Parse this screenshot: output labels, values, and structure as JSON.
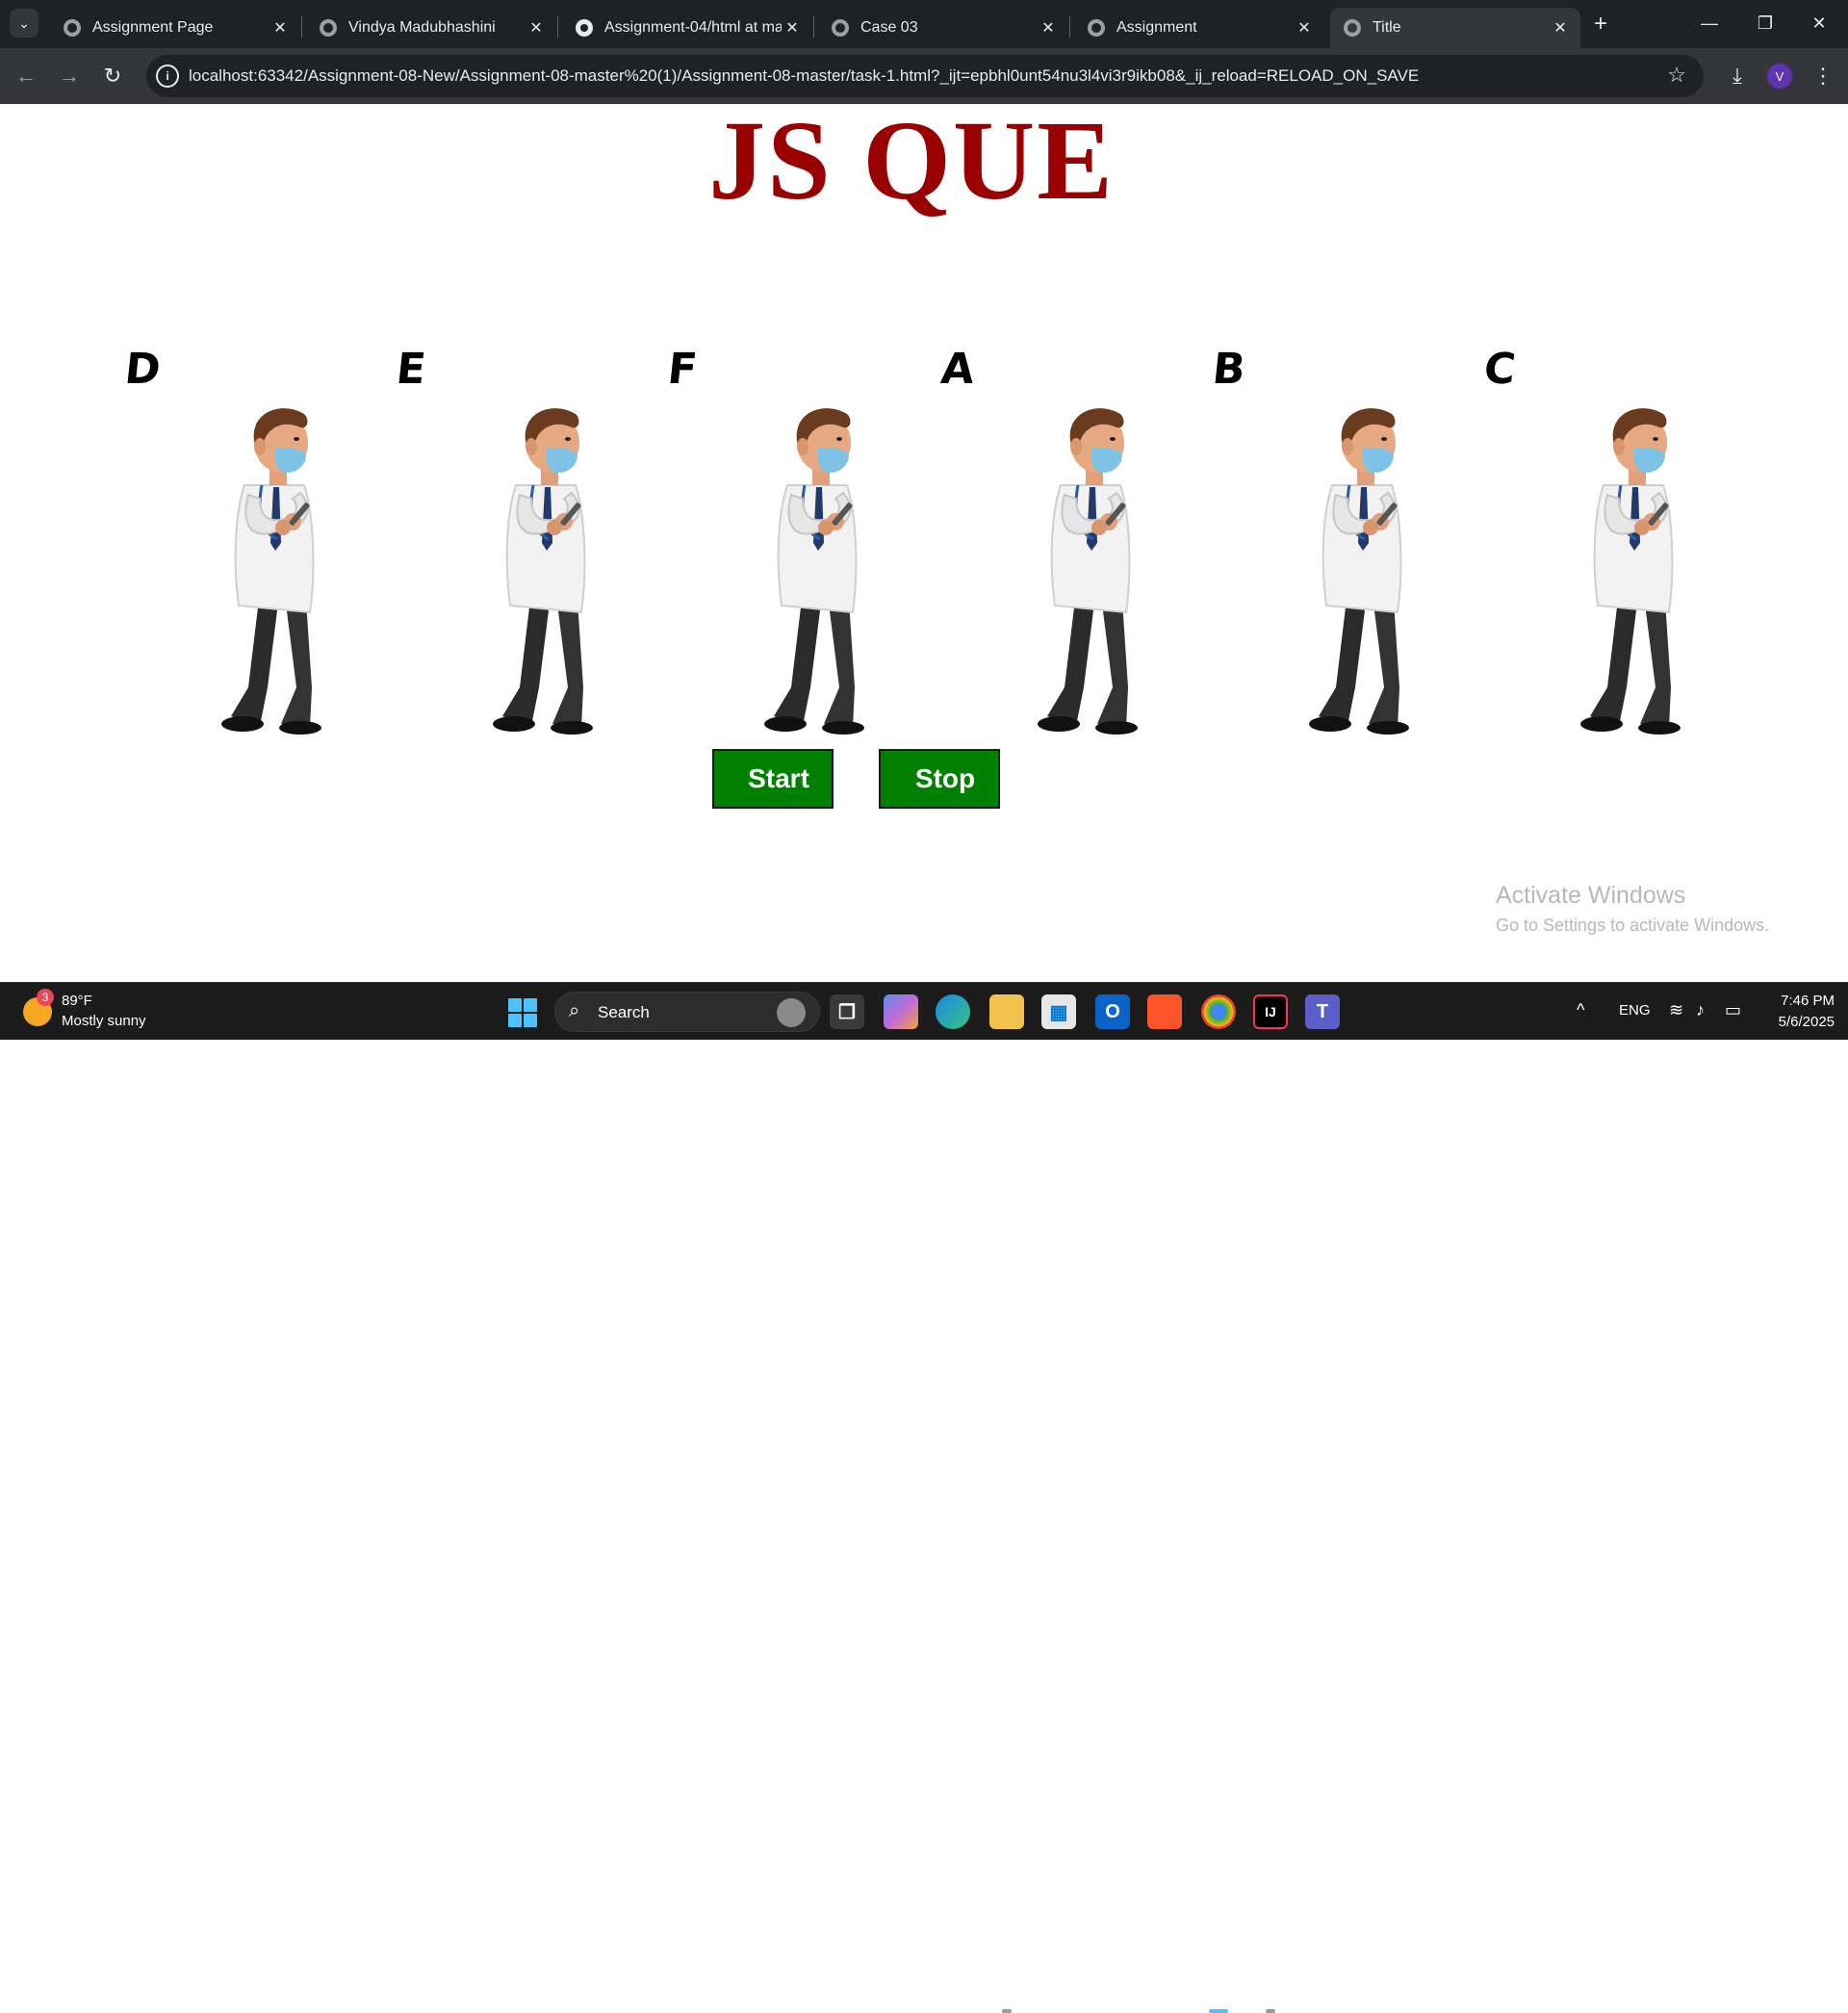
{
  "browser": {
    "tabs": [
      {
        "title": "Assignment Page",
        "icon": "globe-icon"
      },
      {
        "title": "Vindya Madubhashini",
        "icon": "globe-icon"
      },
      {
        "title": "Assignment-04/html at ma",
        "icon": "github-icon"
      },
      {
        "title": "Case 03",
        "icon": "globe-icon"
      },
      {
        "title": "Assignment",
        "icon": "globe-icon"
      },
      {
        "title": "Title",
        "icon": "globe-icon",
        "active": true
      }
    ],
    "close_glyph": "✕",
    "new_tab_glyph": "+",
    "url": "localhost:63342/Assignment-08-New/Assignment-08-master%20(1)/Assignment-08-master/task-1.html?_ijt=epbhl0unt54nu3l4vi3r9ikb08&_ij_reload=RELOAD_ON_SAVE",
    "profile_initial": "V"
  },
  "page": {
    "heading": "JS QUE",
    "queue": [
      "D",
      "E",
      "F",
      "A",
      "B",
      "C"
    ],
    "character": "doctor-with-phone-image",
    "buttons": {
      "start": "Start",
      "stop": "Stop"
    },
    "button_color": "#008000",
    "heading_color": "#990000"
  },
  "watermark": {
    "title": "Activate Windows",
    "subtitle": "Go to Settings to activate Windows."
  },
  "taskbar": {
    "weather_badge": "3",
    "temperature": "89°F",
    "condition": "Mostly sunny",
    "search_label": "Search",
    "language": "ENG",
    "time": "7:46 PM",
    "date": "5/6/2025"
  }
}
